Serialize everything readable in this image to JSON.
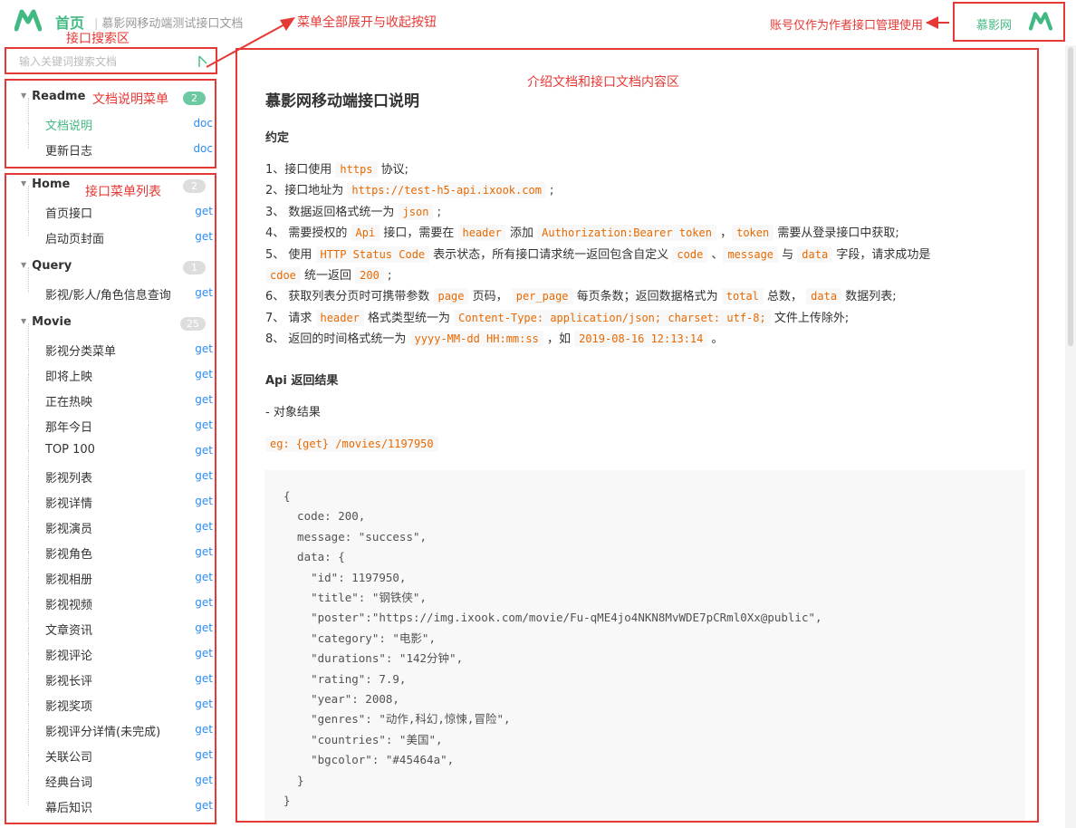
{
  "header": {
    "home_title": "首页",
    "subtitle": "慕影网移动端测试接口文档",
    "brand_name": "慕影网"
  },
  "annotations": {
    "search_area": "接口搜索区",
    "toggle_button": "菜单全部展开与收起按钮",
    "account_note": "账号仅作为作者接口管理使用",
    "doc_menu": "文档说明菜单",
    "api_menu": "接口菜单列表",
    "content_area": "介绍文档和接口文档内容区"
  },
  "search": {
    "placeholder": "输入关键词搜索文档"
  },
  "sidebar": {
    "groups": [
      {
        "title": "Readme",
        "count": "2",
        "items": [
          {
            "label": "文档说明",
            "method": "doc"
          },
          {
            "label": "更新日志",
            "method": "doc"
          }
        ]
      },
      {
        "title": "Home",
        "count": "2",
        "items": [
          {
            "label": "首页接口",
            "method": "get"
          },
          {
            "label": "启动页封面",
            "method": "get"
          }
        ]
      },
      {
        "title": "Query",
        "count": "1",
        "items": [
          {
            "label": "影视/影人/角色信息查询",
            "method": "get"
          }
        ]
      },
      {
        "title": "Movie",
        "count": "25",
        "items": [
          {
            "label": "影视分类菜单",
            "method": "get"
          },
          {
            "label": "即将上映",
            "method": "get"
          },
          {
            "label": "正在热映",
            "method": "get"
          },
          {
            "label": "那年今日",
            "method": "get"
          },
          {
            "label": "TOP 100",
            "method": "get"
          },
          {
            "label": "影视列表",
            "method": "get"
          },
          {
            "label": "影视详情",
            "method": "get"
          },
          {
            "label": "影视演员",
            "method": "get"
          },
          {
            "label": "影视角色",
            "method": "get"
          },
          {
            "label": "影视相册",
            "method": "get"
          },
          {
            "label": "影视视频",
            "method": "get"
          },
          {
            "label": "文章资讯",
            "method": "get"
          },
          {
            "label": "影视评论",
            "method": "get"
          },
          {
            "label": "影视长评",
            "method": "get"
          },
          {
            "label": "影视奖项",
            "method": "get"
          },
          {
            "label": "影视评分详情(未完成)",
            "method": "get"
          },
          {
            "label": "关联公司",
            "method": "get"
          },
          {
            "label": "经典台词",
            "method": "get"
          },
          {
            "label": "幕后知识",
            "method": "get"
          }
        ]
      }
    ]
  },
  "content": {
    "title": "慕影网移动端接口说明",
    "section1": "约定",
    "rules": [
      [
        "1、接口使用 ",
        {
          "c": "https"
        },
        " 协议;"
      ],
      [
        "2、接口地址为 ",
        {
          "c": "https://test-h5-api.ixook.com"
        },
        " ;"
      ],
      [
        "3、 数据返回格式统一为 ",
        {
          "c": "json"
        },
        " ;"
      ],
      [
        "4、 需要授权的 ",
        {
          "c": "Api"
        },
        " 接口，需要在 ",
        {
          "c": "header"
        },
        " 添加 ",
        {
          "c": "Authorization:Bearer token"
        },
        " ，",
        {
          "c": "token"
        },
        " 需要从登录接口中获取;"
      ],
      [
        "5、 使用 ",
        {
          "c": "HTTP Status Code"
        },
        " 表示状态，所有接口请求统一返回包含自定义 ",
        {
          "c": "code"
        },
        " 、",
        {
          "c": "message"
        },
        " 与 ",
        {
          "c": "data"
        },
        " 字段，请求成功是"
      ],
      [
        {
          "c": "cdoe"
        },
        " 统一返回 ",
        {
          "c": "200"
        },
        " ;"
      ],
      [
        "6、 获取列表分页时可携带参数 ",
        {
          "c": "page"
        },
        " 页码， ",
        {
          "c": "per_page"
        },
        " 每页条数；返回数据格式为 ",
        {
          "c": "total"
        },
        " 总数， ",
        {
          "c": "data"
        },
        " 数据列表;"
      ],
      [
        "7、 请求 ",
        {
          "c": "header"
        },
        " 格式类型统一为 ",
        {
          "c": "Content-Type: application/json; charset: utf-8;"
        },
        " 文件上传除外;"
      ],
      [
        "8、 返回的时间格式统一为 ",
        {
          "c": "yyyy-MM-dd HH:mm:ss"
        },
        " ，如 ",
        {
          "c": "2019-08-16 12:13:14"
        },
        " 。"
      ]
    ],
    "section2": "Api 返回结果",
    "object_label": "- 对象结果",
    "example": "eg: {get} /movies/1197950",
    "code_lines": [
      "{",
      "  code: 200,",
      "  message: \"success\",",
      "  data: {",
      "    \"id\": 1197950,",
      "    \"title\": \"钢铁侠\",",
      "    \"poster\":\"https://img.ixook.com/movie/Fu-qME4jo4NKN8MvWDE7pCRml0Xx@public\",",
      "    \"category\": \"电影\",",
      "    \"durations\": \"142分钟\",",
      "    \"rating\": 7.9,",
      "    \"year\": 2008,",
      "    \"genres\": \"动作,科幻,惊悚,冒险\",",
      "    \"countries\": \"美国\",",
      "    \"bgcolor\": \"#45464a\",",
      "  }",
      "}"
    ]
  },
  "colors": {
    "accent": "#42b983",
    "method": "#2e8df0",
    "annotation": "#e53935",
    "code": "#e96900"
  }
}
